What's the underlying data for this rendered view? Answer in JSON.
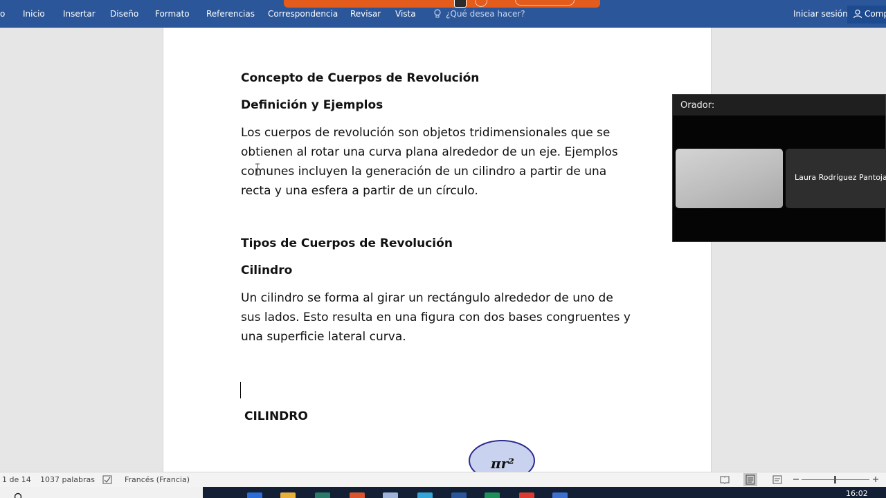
{
  "ribbon": {
    "tabs": [
      {
        "label": "o"
      },
      {
        "label": "Inicio"
      },
      {
        "label": "Insertar"
      },
      {
        "label": "Diseño"
      },
      {
        "label": "Formato"
      },
      {
        "label": "Referencias"
      },
      {
        "label": "Correspondencia"
      },
      {
        "label": "Revisar"
      },
      {
        "label": "Vista"
      }
    ],
    "help_placeholder": "¿Qué desea hacer?",
    "signin": "Iniciar sesión",
    "share": "Compartir"
  },
  "document": {
    "title": "Concepto de Cuerpos de Revolución",
    "subtitle": "Definición y Ejemplos",
    "para1_lines": [
      "Los cuerpos de revolución son objetos tridimensionales que se",
      "obtienen al rotar una curva plana alrededor de un eje. Ejemplos",
      "comunes incluyen la generación de un cilindro a partir de una",
      "recta y una esfera a partir de un círculo."
    ],
    "section": "Tipos de Cuerpos de Revolución",
    "subsection": "Cilindro",
    "para2_lines": [
      "Un cilindro se forma al girar un rectángulo alrededor de uno de",
      "sus lados. Esto resulta en una figura con dos bases congruentes y",
      "una superficie lateral curva."
    ],
    "figure_label": "CILINDRO",
    "formula": "πr²"
  },
  "speaker": {
    "title": "Orador:",
    "participant": "Laura Rodríguez Pantoja"
  },
  "status_bar": {
    "page": "1 de 14",
    "words": "1037 palabras",
    "language": "Francés (Francia)"
  },
  "taskbar": {
    "time": "16:02"
  },
  "colors": {
    "ribbon": "#2b579a",
    "share_bar": "#e45c1c",
    "speaker_bg": "#050505"
  }
}
